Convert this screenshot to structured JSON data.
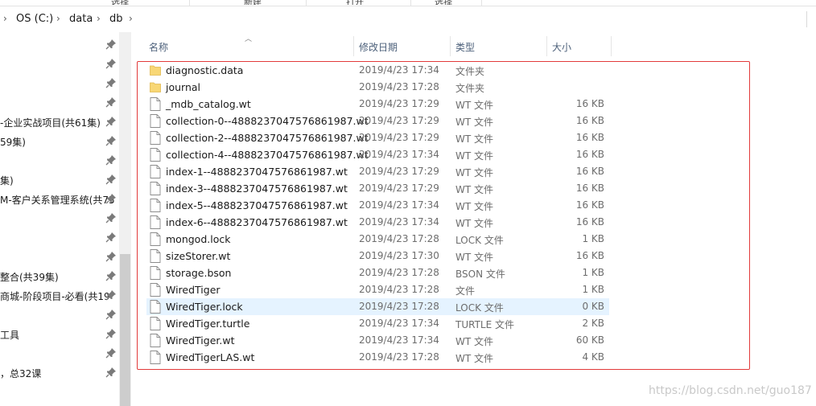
{
  "ribbon": {
    "tabs": [
      "选择",
      "新建",
      "打开",
      "选择"
    ]
  },
  "address": {
    "crumbs": [
      "OS (C:)",
      "data",
      "db"
    ],
    "separator": "›"
  },
  "nav": {
    "items": [
      {
        "label": ""
      },
      {
        "label": ""
      },
      {
        "label": ""
      },
      {
        "label": ""
      },
      {
        "label": "-企业实战项目(共61集)"
      },
      {
        "label": "59集)"
      },
      {
        "label": ""
      },
      {
        "label": "集)"
      },
      {
        "label": "M-客户关系管理系统(共75"
      },
      {
        "label": ""
      },
      {
        "label": ""
      },
      {
        "label": ""
      },
      {
        "label": "整合(共39集)"
      },
      {
        "label": "商城-阶段项目-必看(共19"
      },
      {
        "label": ""
      },
      {
        "label": "工具"
      },
      {
        "label": ""
      },
      {
        "label": "，总32课"
      }
    ]
  },
  "columns": {
    "name": "名称",
    "date": "修改日期",
    "type": "类型",
    "size": "大小"
  },
  "files": [
    {
      "name": "diagnostic.data",
      "date": "2019/4/23 17:34",
      "type": "文件夹",
      "size": "",
      "kind": "folder"
    },
    {
      "name": "journal",
      "date": "2019/4/23 17:28",
      "type": "文件夹",
      "size": "",
      "kind": "folder"
    },
    {
      "name": "_mdb_catalog.wt",
      "date": "2019/4/23 17:29",
      "type": "WT 文件",
      "size": "16 KB",
      "kind": "file"
    },
    {
      "name": "collection-0--4888237047576861987.wt",
      "date": "2019/4/23 17:29",
      "type": "WT 文件",
      "size": "16 KB",
      "kind": "file"
    },
    {
      "name": "collection-2--4888237047576861987.wt",
      "date": "2019/4/23 17:29",
      "type": "WT 文件",
      "size": "16 KB",
      "kind": "file"
    },
    {
      "name": "collection-4--4888237047576861987.wt",
      "date": "2019/4/23 17:34",
      "type": "WT 文件",
      "size": "16 KB",
      "kind": "file"
    },
    {
      "name": "index-1--4888237047576861987.wt",
      "date": "2019/4/23 17:29",
      "type": "WT 文件",
      "size": "16 KB",
      "kind": "file"
    },
    {
      "name": "index-3--4888237047576861987.wt",
      "date": "2019/4/23 17:29",
      "type": "WT 文件",
      "size": "16 KB",
      "kind": "file"
    },
    {
      "name": "index-5--4888237047576861987.wt",
      "date": "2019/4/23 17:34",
      "type": "WT 文件",
      "size": "16 KB",
      "kind": "file"
    },
    {
      "name": "index-6--4888237047576861987.wt",
      "date": "2019/4/23 17:34",
      "type": "WT 文件",
      "size": "16 KB",
      "kind": "file"
    },
    {
      "name": "mongod.lock",
      "date": "2019/4/23 17:28",
      "type": "LOCK 文件",
      "size": "1 KB",
      "kind": "file"
    },
    {
      "name": "sizeStorer.wt",
      "date": "2019/4/23 17:30",
      "type": "WT 文件",
      "size": "16 KB",
      "kind": "file"
    },
    {
      "name": "storage.bson",
      "date": "2019/4/23 17:28",
      "type": "BSON 文件",
      "size": "1 KB",
      "kind": "file"
    },
    {
      "name": "WiredTiger",
      "date": "2019/4/23 17:28",
      "type": "文件",
      "size": "1 KB",
      "kind": "file"
    },
    {
      "name": "WiredTiger.lock",
      "date": "2019/4/23 17:28",
      "type": "LOCK 文件",
      "size": "0 KB",
      "kind": "file",
      "selected": true
    },
    {
      "name": "WiredTiger.turtle",
      "date": "2019/4/23 17:34",
      "type": "TURTLE 文件",
      "size": "2 KB",
      "kind": "file"
    },
    {
      "name": "WiredTiger.wt",
      "date": "2019/4/23 17:34",
      "type": "WT 文件",
      "size": "60 KB",
      "kind": "file"
    },
    {
      "name": "WiredTigerLAS.wt",
      "date": "2019/4/23 17:28",
      "type": "WT 文件",
      "size": "4 KB",
      "kind": "file"
    }
  ],
  "watermark": "https://blog.csdn.net/guo187",
  "colors": {
    "highlight": "#e23a3a",
    "selection": "#e5f3ff",
    "folder": "#f8d775",
    "header_text": "#4c607a"
  }
}
